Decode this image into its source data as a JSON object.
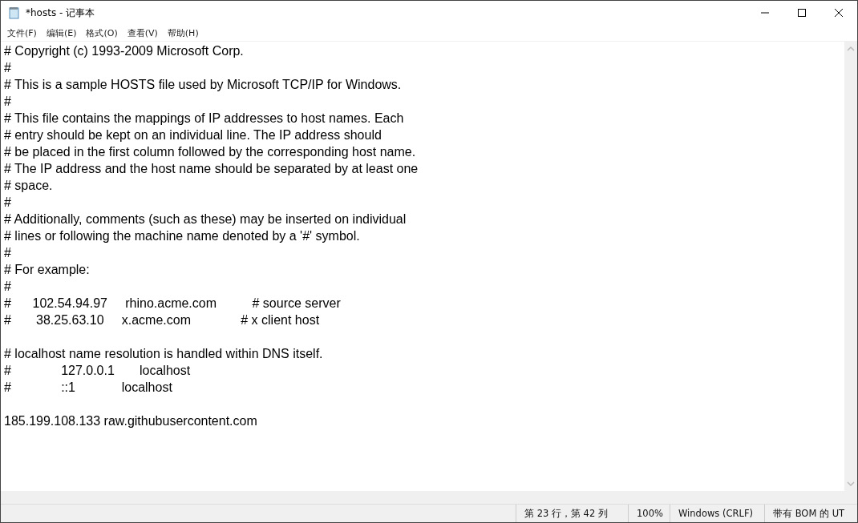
{
  "window": {
    "title": "*hosts - 记事本"
  },
  "menu": [
    {
      "label": "文件(F)"
    },
    {
      "label": "编辑(E)"
    },
    {
      "label": "格式(O)"
    },
    {
      "label": "查看(V)"
    },
    {
      "label": "帮助(H)"
    }
  ],
  "editor": {
    "paragraphs": [
      [
        "# Copyright (c) 1993-2009 Microsoft Corp.",
        "#",
        "# This is a sample HOSTS file used by Microsoft TCP/IP for Windows.",
        "#",
        "# This file contains the mappings of IP addresses to host names. Each",
        "# entry should be kept on an individual line. The IP address should",
        "# be placed in the first column followed by the corresponding host name.",
        "# The IP address and the host name should be separated by at least one",
        "# space.",
        "#",
        "# Additionally, comments (such as these) may be inserted on individual",
        "# lines or following the machine name denoted by a '#' symbol.",
        "#",
        "# For example:",
        "#",
        "#      102.54.94.97     rhino.acme.com          # source server",
        "#       38.25.63.10     x.acme.com              # x client host"
      ],
      [
        "# localhost name resolution is handled within DNS itself.",
        "#              127.0.0.1       localhost",
        "#              ::1             localhost"
      ],
      [
        "185.199.108.133 raw.githubusercontent.com"
      ]
    ]
  },
  "status_bar": {
    "position": "第 23 行，第 42 列",
    "zoom": "100%",
    "line_ending": "Windows (CRLF)",
    "encoding": "带有 BOM 的 UT"
  }
}
